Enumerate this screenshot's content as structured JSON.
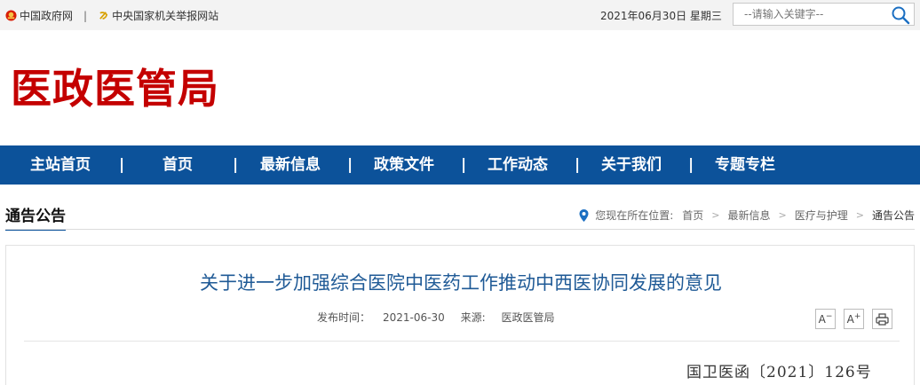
{
  "topbar": {
    "link1": "中国政府网",
    "separator": "|",
    "link2": "中央国家机关举报网站",
    "date": "2021年06月30日",
    "weekday": "星期三",
    "search_placeholder": "--请输入关键字--"
  },
  "logo": {
    "text": "医政医管局"
  },
  "nav": {
    "items": [
      "主站首页",
      "首页",
      "最新信息",
      "政策文件",
      "工作动态",
      "关于我们",
      "专题专栏"
    ],
    "separator": "|"
  },
  "section": {
    "title": "通告公告",
    "location_label": "您现在所在位置:",
    "breadcrumb": [
      "首页",
      "最新信息",
      "医疗与护理"
    ],
    "breadcrumb_current": "通告公告"
  },
  "article": {
    "title": "关于进一步加强综合医院中医药工作推动中西医协同发展的意见",
    "publish_label": "发布时间：",
    "publish_date": "2021-06-30",
    "source_label": "来源:",
    "source": "医政医管局",
    "font_smaller_label": "A",
    "font_larger_label": "A",
    "doc_number": "国卫医函〔2021〕126号"
  },
  "colors": {
    "brand_red": "#c40000",
    "nav_blue": "#0c529a",
    "title_blue": "#1f5a96"
  }
}
